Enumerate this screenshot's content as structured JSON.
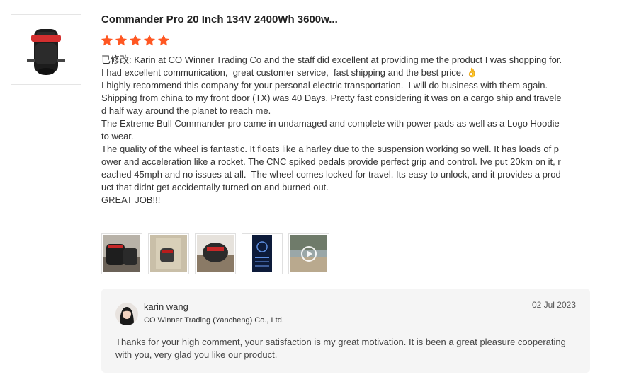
{
  "product": {
    "title": "Commander Pro 20 Inch 134V 2400Wh 3600w...",
    "rating": 5,
    "star_color": "#ff5722",
    "thumb_icon": "electric-unicycle"
  },
  "review": {
    "text": "已修改: Karin at CO Winner Trading Co and the staff did excellent at providing me the product I was shopping for. I had excellent communication,  great customer service,  fast shipping and the best price. 👌\nI highly recommend this company for your personal electric transportation.  I will do business with them again.\nShipping from china to my front door (TX) was 40 Days. Pretty fast considering it was on a cargo ship and traveled half way around the planet to reach me.\nThe Extreme Bull Commander pro came in undamaged and complete with power pads as well as a Logo Hoodie to wear.\nThe quality of the wheel is fantastic. It floats like a harley due to the suspension working so well. It has loads of power and acceleration like a rocket. The CNC spiked pedals provide perfect grip and control. Ive put 20km on it, reached 45mph and no issues at all.  The wheel comes locked for travel. Its easy to unlock, and it provides a product that didnt get accidentally turned on and burned out.\nGREAT JOB!!!",
    "photos": [
      "photo-unicycle-box",
      "photo-unicycle-floor",
      "photo-unicycle-pads",
      "photo-phone-app",
      "photo-video-outdoor"
    ]
  },
  "reply": {
    "seller_name": "karin wang",
    "company": "CO Winner Trading (Yancheng) Co., Ltd.",
    "date": "02 Jul 2023",
    "text": "Thanks for your high comment, your satisfaction is my great motivation. It is been a great pleasure cooperating with you, very glad you like our product."
  }
}
